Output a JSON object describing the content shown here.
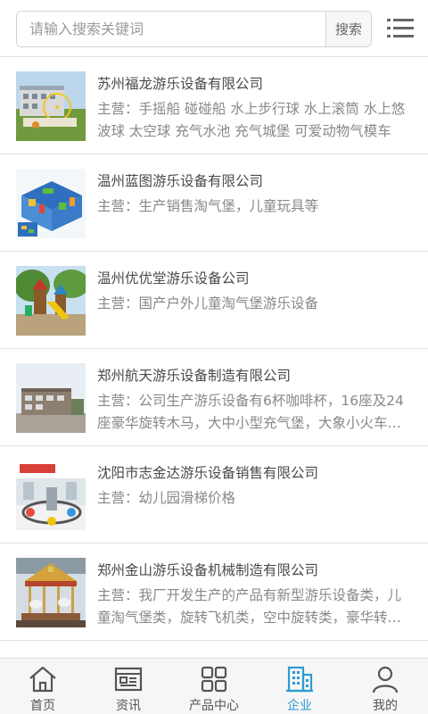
{
  "search": {
    "placeholder": "请输入搜索关键词",
    "button_label": "搜索",
    "menu_icon": "menu-list-icon"
  },
  "companies": [
    {
      "name": "苏州福龙游乐设备有限公司",
      "desc": "主营：手摇船 碰碰船 水上步行球 水上滚筒 水上悠波球 太空球 充气水池 充气城堡 可爱动物气模车",
      "thumb": "building-with-ferris-wheel-photo"
    },
    {
      "name": "温州蓝图游乐设备有限公司",
      "desc": "主营：生产销售淘气堡，儿童玩具等",
      "thumb": "indoor-playground-photo"
    },
    {
      "name": "温州优优堂游乐设备公司",
      "desc": "主营：国产户外儿童淘气堡游乐设备",
      "thumb": "outdoor-playground-photo"
    },
    {
      "name": "郑州航天游乐设备制造有限公司",
      "desc": "主营：公司生产游乐设备有6杯咖啡杯，16座及24座豪华旋转木马，大中小型充气堡，大象小火车…",
      "thumb": "factory-building-photo"
    },
    {
      "name": "沈阳市志金达游乐设备销售有限公司",
      "desc": "主营：幼儿园滑梯价格",
      "thumb": "kiddie-ride-photo"
    },
    {
      "name": "郑州金山游乐设备机械制造有限公司",
      "desc": "主营：我厂开发生产的产品有新型游乐设备类，儿童淘气堡类，旋转飞机类，空中旋转类，豪华转…",
      "thumb": "carousel-photo"
    }
  ],
  "nav": [
    {
      "label": "首页",
      "icon": "home-icon",
      "active": false
    },
    {
      "label": "资讯",
      "icon": "news-icon",
      "active": false
    },
    {
      "label": "产品中心",
      "icon": "grid-icon",
      "active": false
    },
    {
      "label": "企业",
      "icon": "building-icon",
      "active": true
    },
    {
      "label": "我的",
      "icon": "user-icon",
      "active": false
    }
  ],
  "colors": {
    "accent": "#2b9bd0",
    "text": "#4a4a4a",
    "muted": "#888888",
    "divider": "#e2e2e2"
  }
}
